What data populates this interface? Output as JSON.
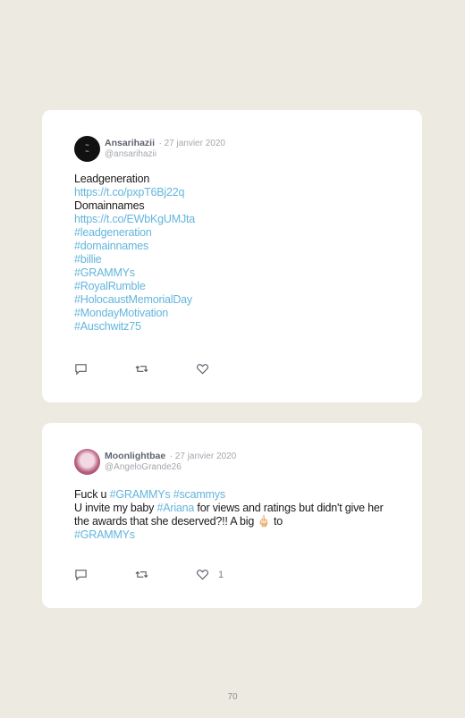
{
  "tweets": [
    {
      "author": "Ansarihazii",
      "date": "· 27 janvier 2020",
      "handle": "@ansarihazii",
      "lines": [
        {
          "text": "Leadgeneration",
          "link": false
        },
        {
          "text": "https://t.co/pxpT6Bj22q",
          "link": true
        },
        {
          "text": "Domainnames",
          "link": false
        },
        {
          "text": "https://t.co/EWbKgUMJta",
          "link": true
        },
        {
          "text": "#leadgeneration",
          "link": true
        },
        {
          "text": "#domainnames",
          "link": true
        },
        {
          "text": "#billie",
          "link": true
        },
        {
          "text": "#GRAMMYs",
          "link": true
        },
        {
          "text": "#RoyalRumble",
          "link": true
        },
        {
          "text": "#HolocaustMemorialDay",
          "link": true
        },
        {
          "text": "#MondayMotivation",
          "link": true
        },
        {
          "text": "#Auschwitz75",
          "link": true
        }
      ],
      "likes": ""
    },
    {
      "author": "Moonlightbae",
      "date": "· 27 janvier 2020",
      "handle": "@AngeloGrande26",
      "body": {
        "p1_text": "Fuck u ",
        "p1_tag1": "#GRAMMYs",
        "p1_tag2": "#scammys",
        "p2_a": "U invite my baby ",
        "p2_tag": "#Ariana",
        "p2_b": " for views and ratings but didn't give her the awards that she deserved?!! A big ",
        "emoji": "🖕🏻",
        "p2_c": " to",
        "p3_tag": "#GRAMMYs"
      },
      "likes": "1"
    }
  ],
  "icons": {
    "reply": "reply-icon",
    "retweet": "retweet-icon",
    "like": "heart-icon"
  },
  "page_number": "70",
  "colors": {
    "background": "#edebe1",
    "card": "#ffffff",
    "link": "#63b5dc",
    "meta": "#a3a7ad"
  }
}
